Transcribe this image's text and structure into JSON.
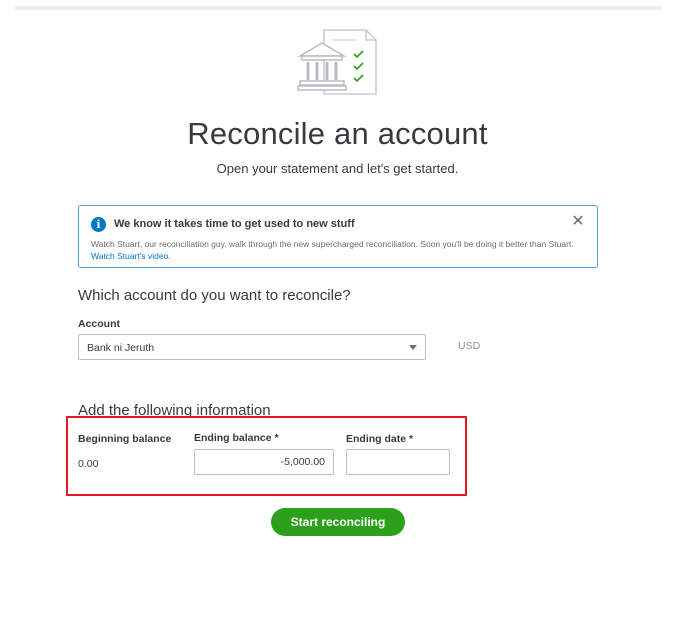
{
  "header": {
    "title": "Reconcile an account",
    "subtitle": "Open your statement and let's get started."
  },
  "info_banner": {
    "icon": "info-icon",
    "title": "We know it takes time to get used to new stuff",
    "body": "Watch Stuart, our reconciliation guy, walk through the new supercharged reconciliation. Soon you'll be doing it better than Stuart.",
    "link_text": "Watch Stuart's video.",
    "close_icon": "close-icon"
  },
  "account_section": {
    "question": "Which account do you want to reconcile?",
    "account_label": "Account",
    "account_value": "Bank ni Jeruth",
    "currency": "USD"
  },
  "info_section": {
    "title": "Add the following information",
    "beginning_balance_label": "Beginning balance",
    "beginning_balance_value": "0.00",
    "ending_balance_label": "Ending balance *",
    "ending_balance_value": "-5,000.00",
    "ending_date_label": "Ending date *",
    "ending_date_value": ""
  },
  "actions": {
    "start_label": "Start reconciling"
  },
  "colors": {
    "primary_green": "#2ca01c",
    "link_blue": "#0077c5",
    "highlight_red": "#e8191e",
    "banner_border": "#4aa0d5"
  }
}
